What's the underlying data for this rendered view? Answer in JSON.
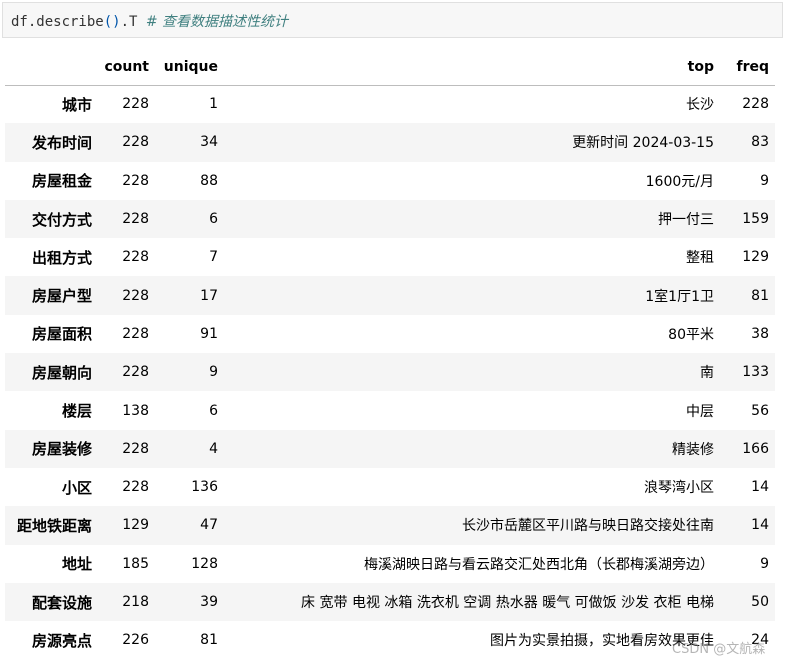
{
  "cell": {
    "code_prefix": "df.describe",
    "code_parens": "()",
    "code_suffix": ".T",
    "comment": "# 查看数据描述性统计"
  },
  "table": {
    "columns": [
      "",
      "count",
      "unique",
      "top",
      "freq"
    ],
    "rows": [
      {
        "index": "城市",
        "count": "228",
        "unique": "1",
        "top": "长沙",
        "freq": "228"
      },
      {
        "index": "发布时间",
        "count": "228",
        "unique": "34",
        "top": "更新时间 2024-03-15",
        "freq": "83"
      },
      {
        "index": "房屋租金",
        "count": "228",
        "unique": "88",
        "top": "1600元/月",
        "freq": "9"
      },
      {
        "index": "交付方式",
        "count": "228",
        "unique": "6",
        "top": "押一付三",
        "freq": "159"
      },
      {
        "index": "出租方式",
        "count": "228",
        "unique": "7",
        "top": "整租",
        "freq": "129"
      },
      {
        "index": "房屋户型",
        "count": "228",
        "unique": "17",
        "top": "1室1厅1卫",
        "freq": "81"
      },
      {
        "index": "房屋面积",
        "count": "228",
        "unique": "91",
        "top": "80平米",
        "freq": "38"
      },
      {
        "index": "房屋朝向",
        "count": "228",
        "unique": "9",
        "top": "南",
        "freq": "133"
      },
      {
        "index": "楼层",
        "count": "138",
        "unique": "6",
        "top": "中层",
        "freq": "56"
      },
      {
        "index": "房屋装修",
        "count": "228",
        "unique": "4",
        "top": "精装修",
        "freq": "166"
      },
      {
        "index": "小区",
        "count": "228",
        "unique": "136",
        "top": "浪琴湾小区",
        "freq": "14"
      },
      {
        "index": "距地铁距离",
        "count": "129",
        "unique": "47",
        "top": "长沙市岳麓区平川路与映日路交接处往南",
        "freq": "14"
      },
      {
        "index": "地址",
        "count": "185",
        "unique": "128",
        "top": "梅溪湖映日路与看云路交汇处西北角（长郡梅溪湖旁边）",
        "freq": "9"
      },
      {
        "index": "配套设施",
        "count": "218",
        "unique": "39",
        "top": "床 宽带 电视 冰箱 洗衣机 空调 热水器 暖气 可做饭 沙发 衣柜 电梯",
        "freq": "50"
      },
      {
        "index": "房源亮点",
        "count": "226",
        "unique": "81",
        "top": "图片为实景拍摄，实地看房效果更佳",
        "freq": "24"
      }
    ]
  },
  "watermark": "CSDN @文航森"
}
